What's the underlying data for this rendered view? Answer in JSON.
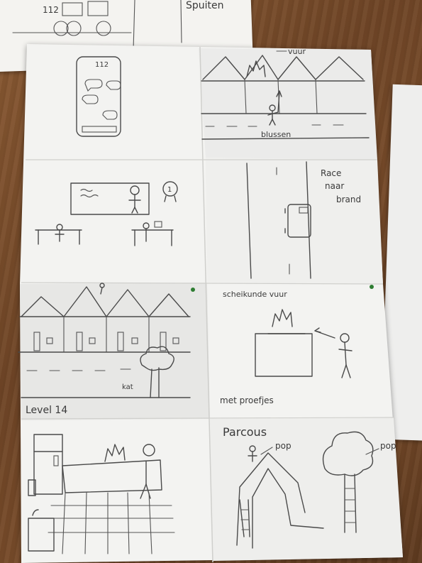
{
  "top_paper": {
    "label_left": "112",
    "label_right": "Spuiten"
  },
  "panels": {
    "p1": {
      "phone_label": "112"
    },
    "p2": {
      "fire_label": "vuur",
      "action_label": "blussen"
    },
    "p3": {
      "badge_label": "1"
    },
    "p4": {
      "race_label_1": "Race",
      "race_label_2": "naar",
      "race_label_3": "brand"
    },
    "p5": {
      "cat_label": "kat",
      "level_label": "Level 14"
    },
    "p6": {
      "title": "scheikunde vuur",
      "caption": "met proefjes"
    },
    "p7": {},
    "p8": {
      "title": "Parcous",
      "pop_left": "pop",
      "pop_right": "pop"
    }
  },
  "colors": {
    "paper": "#f2f2f0",
    "wood": "#7a4d2b",
    "pencil": "#4a4a4a",
    "dot": "#2e7d32"
  }
}
